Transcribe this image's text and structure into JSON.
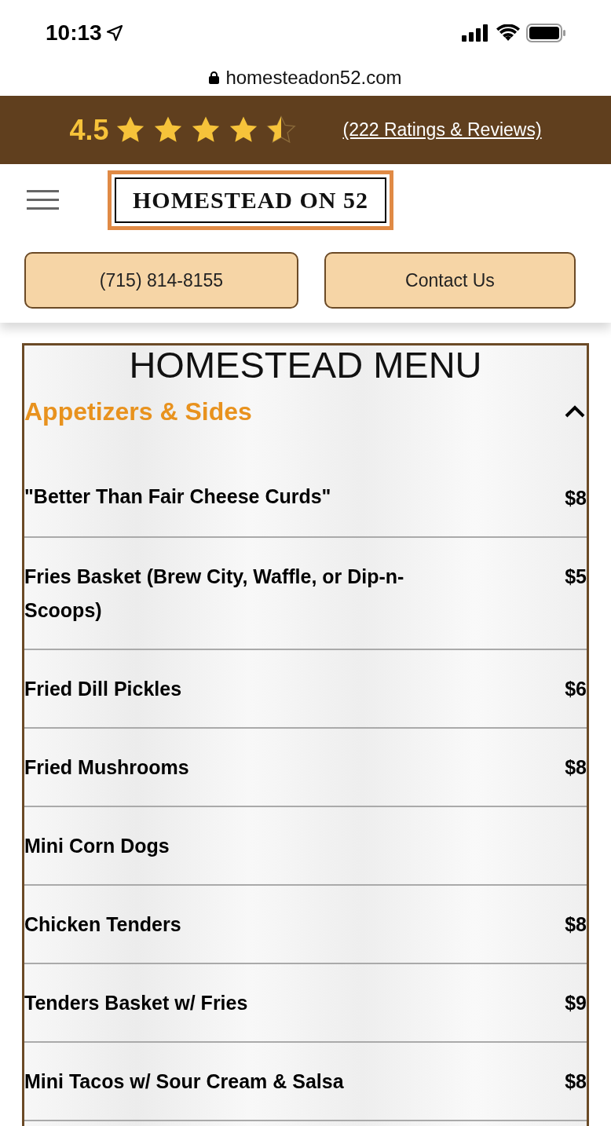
{
  "status_bar": {
    "time": "10:13"
  },
  "url_bar": {
    "url": "homesteadon52.com"
  },
  "rating_bar": {
    "score": "4.5",
    "stars": 4.5,
    "reviews_link": "(222 Ratings & Reviews)"
  },
  "header": {
    "logo_text": "HOMESTEAD ON 52",
    "buttons": [
      "(715) 814-8155",
      "Contact Us"
    ]
  },
  "menu": {
    "title": "HOMESTEAD MENU",
    "section": {
      "title": "Appetizers & Sides",
      "expanded": true
    },
    "items": [
      {
        "name": "\"Better Than Fair Cheese Curds\"",
        "price": "$8"
      },
      {
        "name": "Fries Basket (Brew City, Waffle, or Dip-n-Scoops)",
        "price": "$5"
      },
      {
        "name": "Fried Dill Pickles",
        "price": "$6"
      },
      {
        "name": "Fried Mushrooms",
        "price": "$8"
      },
      {
        "name": "Mini Corn Dogs"
      },
      {
        "name": "Chicken Tenders",
        "price": "$8"
      },
      {
        "name": "Tenders Basket w/ Fries",
        "price": "$9"
      },
      {
        "name": "Mini Tacos w/ Sour Cream & Salsa",
        "price": "$8"
      }
    ]
  }
}
